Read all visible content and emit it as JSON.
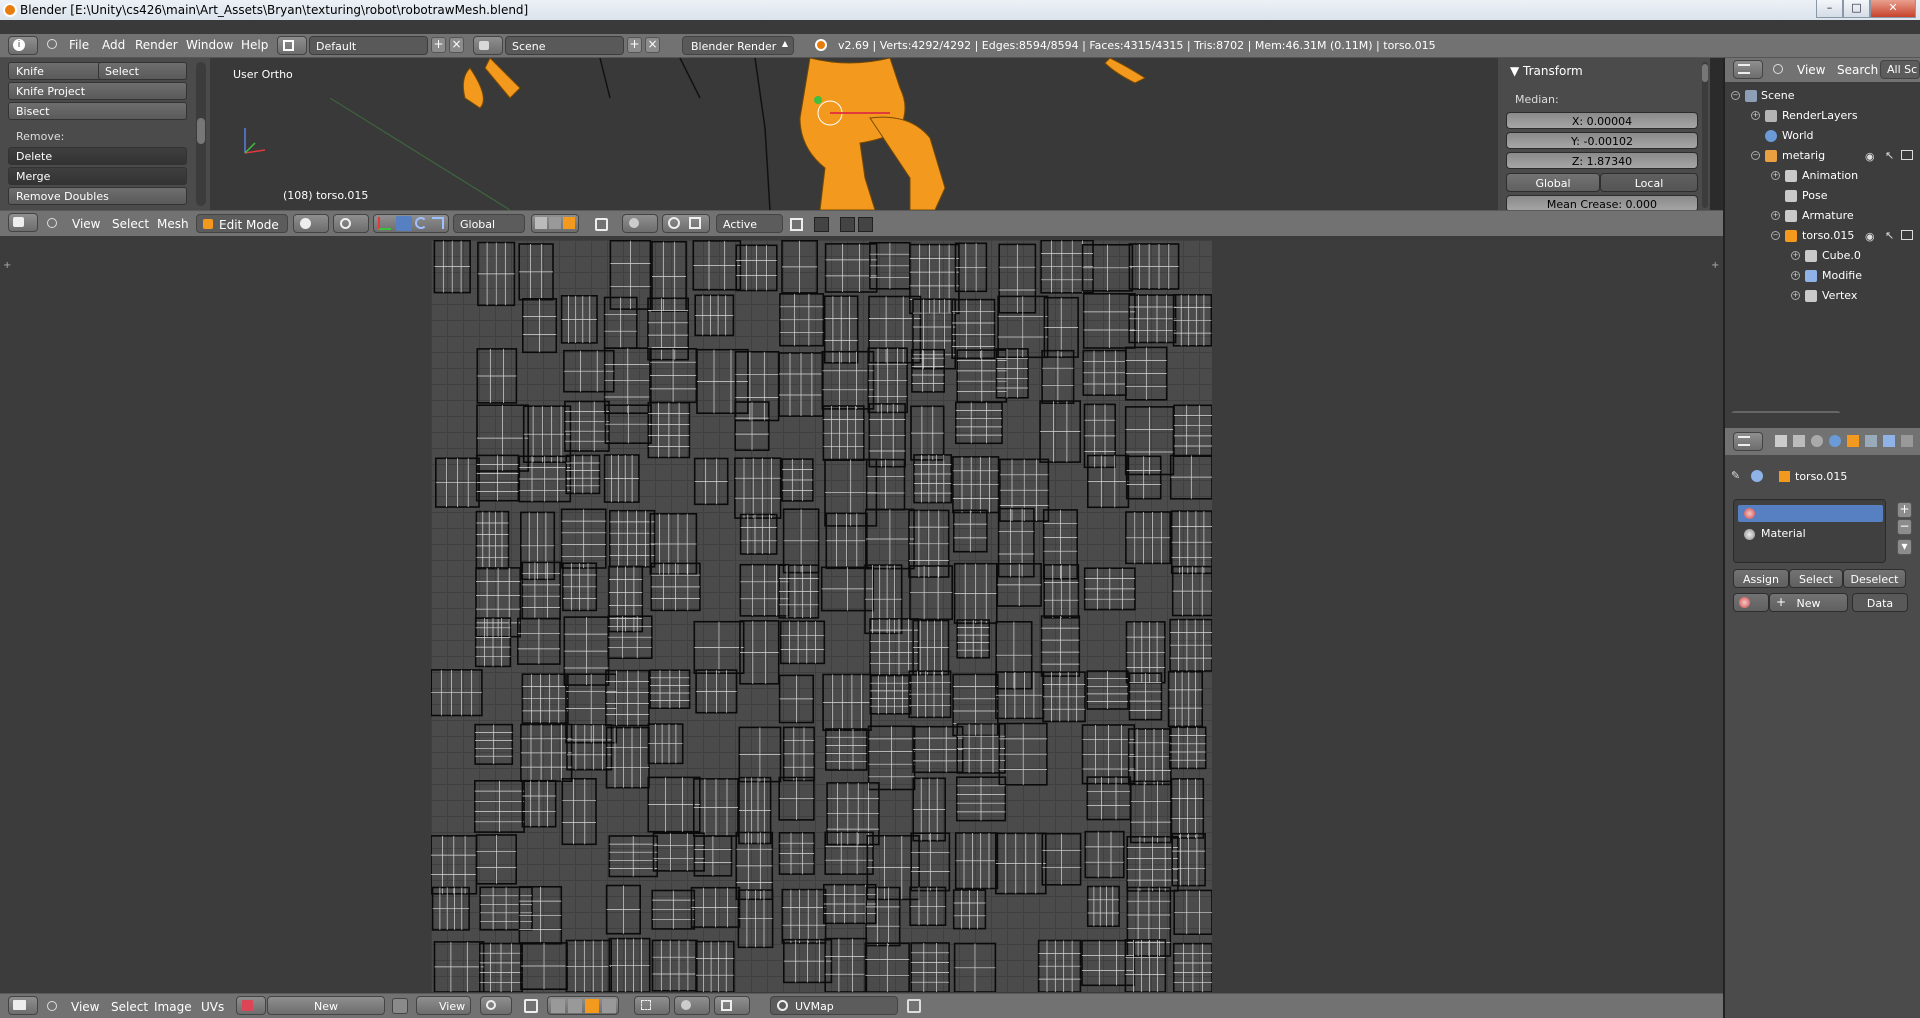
{
  "window": {
    "title": "Blender [E:\\Unity\\cs426\\main\\Art_Assets\\Bryan\\texturing\\robot\\robotrawMesh.blend]",
    "minimize": "–",
    "maximize": "□",
    "close": "✕"
  },
  "info_header": {
    "menus": [
      "File",
      "Add",
      "Render",
      "Window",
      "Help"
    ],
    "layout": "Default",
    "scene": "Scene",
    "engine": "Blender Render",
    "stats": "v2.69 | Verts:4292/4292 | Edges:8594/8594 | Faces:4315/4315 | Tris:8702 | Mem:46.31M (0.11M) | torso.015"
  },
  "toolshelf": {
    "knife": "Knife",
    "select": "Select",
    "knife_project": "Knife Project",
    "bisect": "Bisect",
    "remove_label": "Remove:",
    "delete": "Delete",
    "merge": "Merge",
    "remove_doubles": "Remove Doubles"
  },
  "viewport": {
    "view_name": "User Ortho",
    "object_label": "(108) torso.015"
  },
  "transform_panel": {
    "title": "Transform",
    "median_label": "Median:",
    "x": "X: 0.00004",
    "y": "Y: -0.00102",
    "z": "Z: 1.87340",
    "global": "Global",
    "local": "Local",
    "mean_crease": "Mean Crease: 0.000"
  },
  "header_3d": {
    "menus": [
      "View",
      "Select",
      "Mesh"
    ],
    "mode": "Edit Mode",
    "orientation": "Global",
    "pivot": "Active"
  },
  "outliner": {
    "header": {
      "view": "View",
      "search": "Search",
      "filter": "All Sc"
    },
    "items": [
      {
        "label": "Scene"
      },
      {
        "label": "RenderLayers"
      },
      {
        "label": "World"
      },
      {
        "label": "metarig"
      },
      {
        "label": "Animation"
      },
      {
        "label": "Pose"
      },
      {
        "label": "Armature"
      },
      {
        "label": "torso.015"
      },
      {
        "label": "Cube.0"
      },
      {
        "label": "Modifie"
      },
      {
        "label": "Vertex"
      }
    ]
  },
  "properties": {
    "object": "torso.015",
    "material_slot": "Material",
    "assign": "Assign",
    "select": "Select",
    "deselect": "Deselect",
    "new": "New",
    "data": "Data"
  },
  "uv_header": {
    "menus": [
      "View",
      "Select",
      "Image",
      "UVs"
    ],
    "new": "New",
    "view": "View",
    "uvmap": "UVMap"
  },
  "colors": {
    "mesh_orange": "#f39a1e",
    "selection_blue": "#5680c2",
    "header_gray": "#727272"
  }
}
